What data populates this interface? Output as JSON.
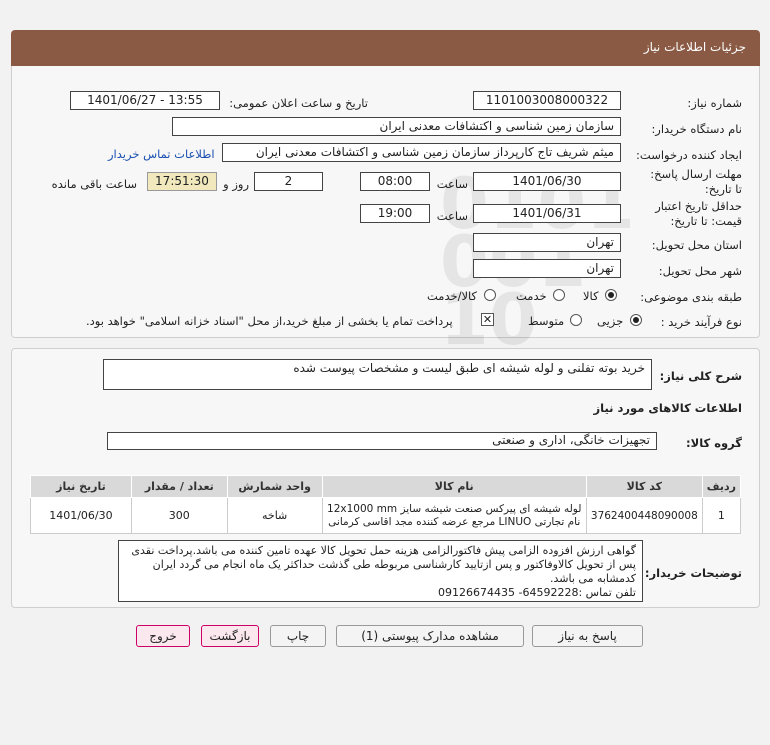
{
  "header": {
    "title": "جزئیات اطلاعات نیاز"
  },
  "fields": {
    "need_number_label": "شماره نیاز:",
    "need_number": "1101003008000322",
    "announce_label": "تاریخ و ساعت اعلان عمومی:",
    "announce_value": "1401/06/27 - 13:55",
    "buyer_org_label": "نام دستگاه خریدار:",
    "buyer_org": "سازمان زمین شناسی و اکتشافات معدنی ایران",
    "creator_label": "ایجاد کننده درخواست:",
    "creator": "میثم شریف تاج کارپرداز سازمان زمین شناسی و اکتشافات معدنی ایران",
    "contact_link": "اطلاعات تماس خریدار",
    "deadline_label": "مهلت ارسال پاسخ: تا تاریخ:",
    "deadline_date": "1401/06/30",
    "time_label": "ساعت",
    "deadline_time": "08:00",
    "days_value": "2",
    "days_label": "روز و",
    "remaining_time": "17:51:30",
    "remaining_label": "ساعت باقی مانده",
    "validity_label": "حداقل تاریخ اعتبار قیمت: تا تاریخ:",
    "validity_date": "1401/06/31",
    "validity_time_label": "ساعت",
    "validity_time": "19:00",
    "delivery_province_label": "استان محل تحویل:",
    "delivery_province": "تهران",
    "delivery_city_label": "شهر محل تحویل:",
    "delivery_city": "تهران",
    "category_label": "طبقه بندی موضوعی:",
    "category_options": [
      "کالا",
      "خدمت",
      "کالا/خدمت"
    ],
    "process_label": "نوع فرآیند خرید :",
    "process_options": [
      "جزیی",
      "متوسط"
    ],
    "payment_note": "پرداخت تمام یا بخشی از مبلغ خرید،از محل \"اسناد خزانه اسلامی\" خواهد بود."
  },
  "summary": {
    "label": "شرح کلی نیاز:",
    "value": "خرید بوته تفلنی و لوله شیشه ای طبق لیست و مشخصات پیوست شده",
    "goods_info_title": "اطلاعات کالاهای مورد نیاز",
    "group_label": "گروه کالا:",
    "group_value": "تجهیزات خانگی، اداری و صنعتی"
  },
  "table": {
    "headers": [
      "ردیف",
      "کد کالا",
      "نام کالا",
      "واحد شمارش",
      "تعداد / مقدار",
      "تاریخ نیاز"
    ],
    "rows": [
      {
        "row": "1",
        "code": "3762400448090008",
        "name": "لوله شیشه ای پیرکس صنعت شیشه سایز 12x1000 mm نام تجارتی LINUO مرجع عرضه کننده مجد اقاسی کرمانی",
        "unit": "شاخه",
        "qty": "300",
        "date": "1401/06/30"
      }
    ]
  },
  "buyer_notes": {
    "label": "توضیحات خریدار:",
    "text": "گواهی ارزش افزوده الزامی پیش فاکتورالزامی هزینه حمل تحویل کالا عهده تامین کننده می باشد.پرداخت نقدی پس از تحویل کالاوفاکتور و پس ازتایید کارشناسی مربوطه طی گذشت حداکثر یک ماه انجام می گردد ایران کدمشابه می باشد.",
    "phone": "تلفن تماس :64592228- 09126674435"
  },
  "buttons": {
    "reply": "پاسخ به نیاز",
    "attachments": "مشاهده مدارک پیوستی (1)",
    "print": "چاپ",
    "back": "بازگشت",
    "exit": "خروج"
  }
}
